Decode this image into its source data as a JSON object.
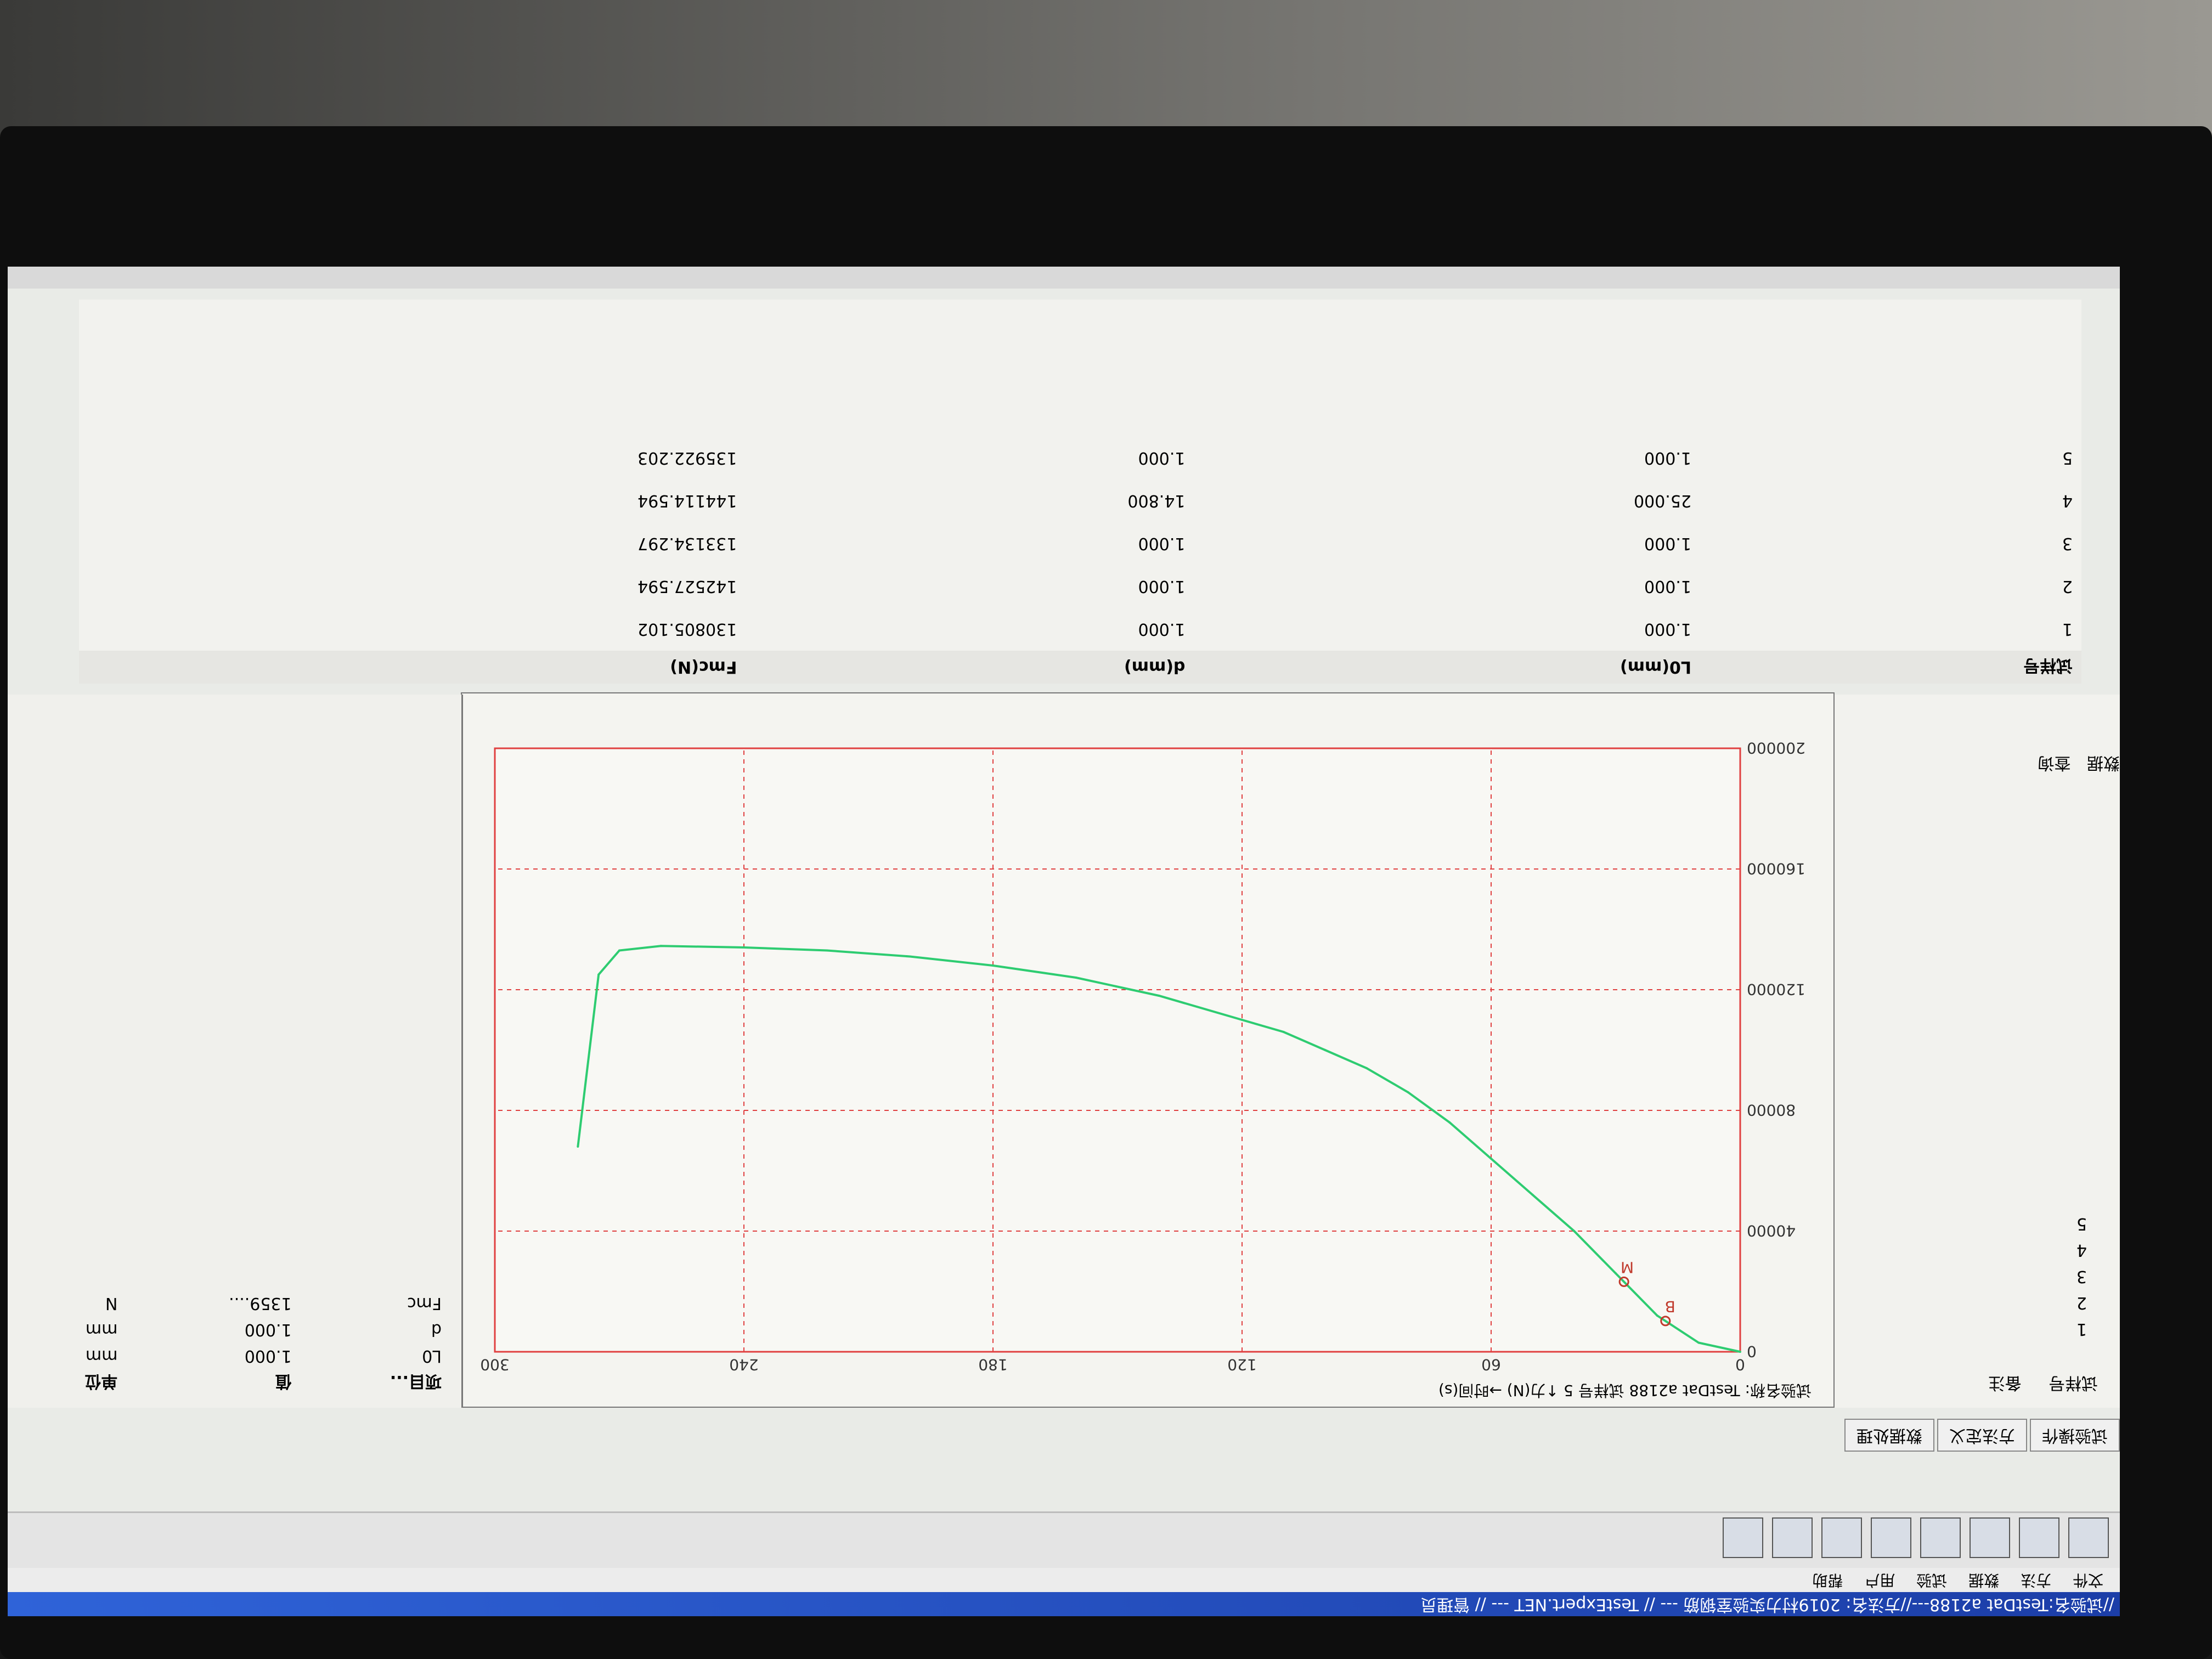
{
  "titlebar": {
    "text": "//试验名:TestDat a2188---//方法名: 2019村力实验室钢筋 --- // TestExpert.NET --- // 管理员"
  },
  "menubar": {
    "items": [
      "文件",
      "方法",
      "数据",
      "试验",
      "用户",
      "帮助"
    ]
  },
  "tabs": [
    "试验操作",
    "方法定义",
    "数据处理"
  ],
  "left_panel": {
    "headers": [
      "试样号",
      "备注"
    ],
    "vertical_tabs": [
      "数据",
      "查询"
    ],
    "specimens": [
      "1",
      "2",
      "3",
      "4",
      "5"
    ]
  },
  "chart_panel": {
    "caption": "试验名称: TestDat a2188    试样号 5    ↑力(N)    →时间(s)"
  },
  "chart_data": {
    "type": "line",
    "x": [
      0,
      10,
      20,
      30,
      40,
      50,
      60,
      70,
      80,
      90,
      100,
      110,
      120,
      140,
      160,
      180,
      200,
      220,
      240,
      260,
      270,
      275,
      280
    ],
    "series": [
      {
        "values": [
          0,
          3000,
          12000,
          26000,
          40000,
          52000,
          64000,
          76000,
          86000,
          94000,
          100000,
          106000,
          110000,
          118000,
          124000,
          128000,
          131000,
          133000,
          134000,
          134500,
          133000,
          125000,
          68000
        ]
      }
    ],
    "markers": [
      {
        "label": "B",
        "x": 18
      },
      {
        "label": "M",
        "x": 28
      }
    ],
    "x_ticks": [
      "0",
      "60",
      "120",
      "180",
      "240",
      "300"
    ],
    "y_ticks": [
      "0",
      "40000",
      "80000",
      "120000",
      "160000",
      "200000"
    ],
    "xlim": [
      0,
      300
    ],
    "ylim": [
      0,
      200000
    ],
    "series_color": "#2ecc71",
    "grid": true,
    "grid_color": "#e04040"
  },
  "right_panel": {
    "headers": [
      "项目...",
      "值",
      "单位"
    ],
    "rows": [
      {
        "item": "L0",
        "value": "1.000",
        "unit": "mm"
      },
      {
        "item": "d",
        "value": "1.000",
        "unit": "mm"
      },
      {
        "item": "Fmc",
        "value": "1359....",
        "unit": "N"
      }
    ]
  },
  "results_table": {
    "headers": [
      "试样号",
      "L0(mm)",
      "d(mm)",
      "Fmc(N)"
    ],
    "rows": [
      {
        "specimen": "1",
        "l0": "1.000",
        "d": "1.000",
        "fmc": "130805.102"
      },
      {
        "specimen": "2",
        "l0": "1.000",
        "d": "1.000",
        "fmc": "142527.594"
      },
      {
        "specimen": "3",
        "l0": "1.000",
        "d": "1.000",
        "fmc": "133134.297"
      },
      {
        "specimen": "4",
        "l0": "25.000",
        "d": "14.800",
        "fmc": "144114.594"
      },
      {
        "specimen": "5",
        "l0": "1.000",
        "d": "1.000",
        "fmc": "135922.203"
      }
    ]
  }
}
